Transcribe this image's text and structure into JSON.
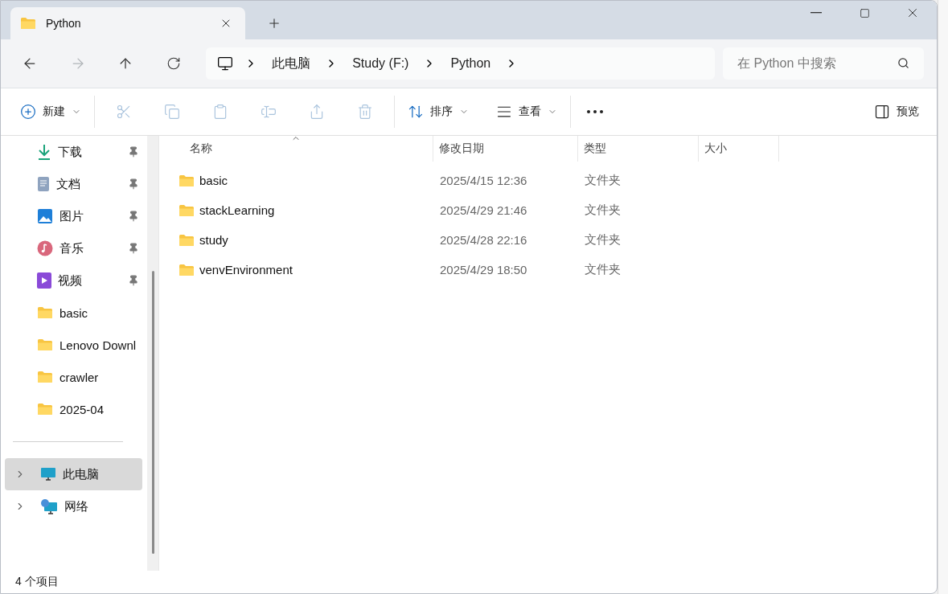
{
  "window": {
    "tab": {
      "title": "Python",
      "selected": true
    }
  },
  "nav": {
    "back_disabled": false,
    "forward_disabled": true
  },
  "breadcrumb": [
    "此电脑",
    "Study (F:)",
    "Python"
  ],
  "search": {
    "placeholder": "在 Python 中搜索"
  },
  "toolbar": {
    "new": "新建",
    "actions": [
      {
        "kind": "cut",
        "disabled": true
      },
      {
        "kind": "copy",
        "disabled": true
      },
      {
        "kind": "paste",
        "disabled": true
      },
      {
        "kind": "rename",
        "disabled": true
      },
      {
        "kind": "share",
        "disabled": true
      },
      {
        "kind": "delete",
        "disabled": true
      }
    ],
    "sort": "排序",
    "view": "查看",
    "preview": "预览"
  },
  "sidebar": {
    "items": [
      {
        "label": "下载",
        "kind": "download",
        "pinned": true
      },
      {
        "label": "文档",
        "kind": "document",
        "pinned": true
      },
      {
        "label": "图片",
        "kind": "picture",
        "pinned": true
      },
      {
        "label": "音乐",
        "kind": "music",
        "pinned": true
      },
      {
        "label": "视频",
        "kind": "video",
        "pinned": true
      },
      {
        "label": "basic",
        "kind": "folder",
        "pinned": false
      },
      {
        "label": "Lenovo Downl",
        "kind": "folder",
        "pinned": false
      },
      {
        "label": "crawler",
        "kind": "folder",
        "pinned": false
      },
      {
        "label": "2025-04",
        "kind": "folder",
        "pinned": false
      }
    ],
    "locations": [
      {
        "label": "此电脑",
        "kind": "pc",
        "selected": true
      },
      {
        "label": "网络",
        "kind": "network",
        "selected": false
      }
    ]
  },
  "table": {
    "columns": [
      {
        "label": "名称",
        "sorted": true
      },
      {
        "label": "修改日期",
        "sorted": false
      },
      {
        "label": "类型",
        "sorted": false
      },
      {
        "label": "大小",
        "sorted": false
      }
    ],
    "rows": [
      {
        "name": "basic",
        "modified": "2025/4/15 12:36",
        "type": "文件夹"
      },
      {
        "name": "stackLearning",
        "modified": "2025/4/29 21:46",
        "type": "文件夹"
      },
      {
        "name": "study",
        "modified": "2025/4/28 22:16",
        "type": "文件夹"
      },
      {
        "name": "venvEnvironment",
        "modified": "2025/4/29 18:50",
        "type": "文件夹"
      }
    ]
  },
  "status_bar": {
    "count": "4 个项目"
  }
}
